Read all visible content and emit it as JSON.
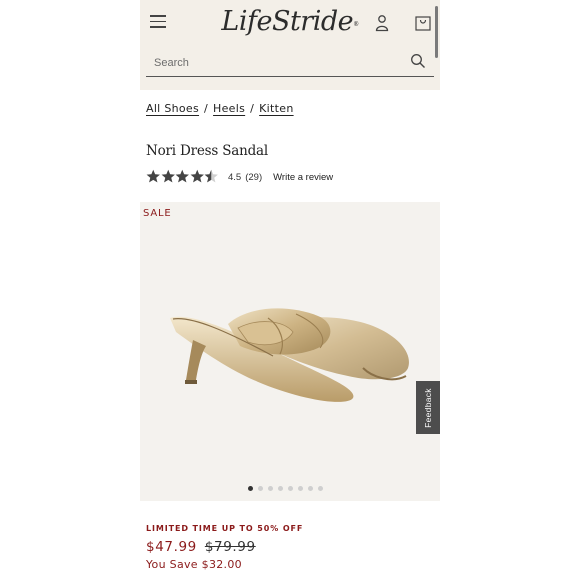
{
  "header": {
    "logo": "LifeStride",
    "logo_mark": "®",
    "search": {
      "placeholder": "Search",
      "value": ""
    },
    "icons": {
      "menu": "hamburger-menu-icon",
      "account": "user-icon",
      "cart": "shopping-bag-icon",
      "search": "search-icon"
    }
  },
  "breadcrumb": {
    "items": [
      "All Shoes",
      "Heels",
      "Kitten"
    ],
    "separator": "/"
  },
  "product": {
    "title": "Nori Dress Sandal",
    "rating": {
      "value": 4.5,
      "value_text": "4.5",
      "count_text": "(29)",
      "max": 5
    },
    "write_review": "Write a review"
  },
  "gallery": {
    "badge": "SALE",
    "total_images": 8,
    "active_index": 0,
    "feedback_label": "Feedback"
  },
  "pricing": {
    "promo": "LIMITED TIME UP TO 50% OFF",
    "sale_price": "$47.99",
    "original_price": "$79.99",
    "you_save": "You Save $32.00"
  },
  "colors": {
    "header_bg": "#f3efe8",
    "sale_red": "#8b1a1a",
    "text_dark": "#222222",
    "image_bg": "#f4f2ee"
  }
}
